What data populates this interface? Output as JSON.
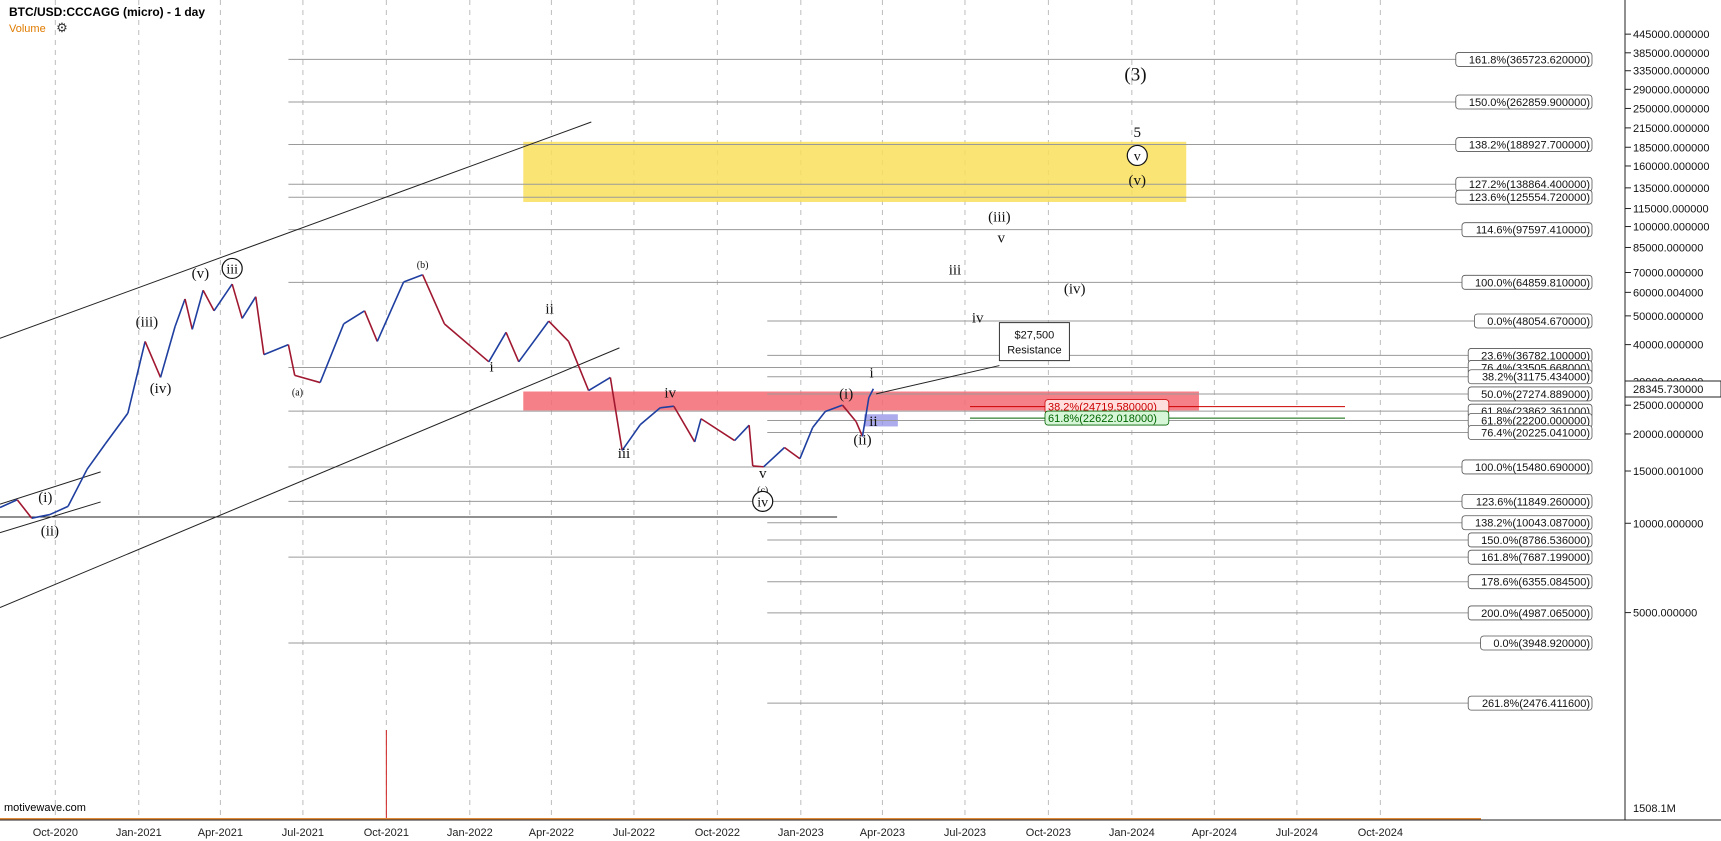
{
  "header": {
    "title": "BTC/USD:CCCAGG (micro) - 1 day",
    "volume_label": "Volume",
    "settings_icon": "gear-icon"
  },
  "watermark": "motivewave.com",
  "colors": {
    "up": "#1f3fa0",
    "down": "#a01830",
    "support_zone": "#f46a73",
    "target_zone": "#f8df5c",
    "blue_box": "#8f8fe8",
    "volume": "#d02020"
  },
  "chart_data": {
    "type": "line",
    "title": "BTC/USD:CCCAGG (micro) - 1 day",
    "y_scale": "log",
    "ylim": [
      1000,
      580000
    ],
    "xlim": [
      "2020-08-01",
      "2025-01-20"
    ],
    "x_ticks": [
      {
        "date": "2020-10-01",
        "label": "Oct-2020"
      },
      {
        "date": "2021-01-01",
        "label": "Jan-2021"
      },
      {
        "date": "2021-04-01",
        "label": "Apr-2021"
      },
      {
        "date": "2021-07-01",
        "label": "Jul-2021"
      },
      {
        "date": "2021-10-01",
        "label": "Oct-2021"
      },
      {
        "date": "2022-01-01",
        "label": "Jan-2022"
      },
      {
        "date": "2022-04-01",
        "label": "Apr-2022"
      },
      {
        "date": "2022-07-01",
        "label": "Jul-2022"
      },
      {
        "date": "2022-10-01",
        "label": "Oct-2022"
      },
      {
        "date": "2023-01-01",
        "label": "Jan-2023"
      },
      {
        "date": "2023-04-01",
        "label": "Apr-2023"
      },
      {
        "date": "2023-07-01",
        "label": "Jul-2023"
      },
      {
        "date": "2023-10-01",
        "label": "Oct-2023"
      },
      {
        "date": "2024-01-01",
        "label": "Jan-2024"
      },
      {
        "date": "2024-04-01",
        "label": "Apr-2024"
      },
      {
        "date": "2024-07-01",
        "label": "Jul-2024"
      },
      {
        "date": "2024-10-01",
        "label": "Oct-2024"
      }
    ],
    "y_ticks": [
      {
        "value": 445000,
        "label": "445000.000000"
      },
      {
        "value": 385000,
        "label": "385000.000000"
      },
      {
        "value": 335000,
        "label": "335000.000000"
      },
      {
        "value": 290000,
        "label": "290000.000000"
      },
      {
        "value": 250000,
        "label": "250000.000000"
      },
      {
        "value": 215000,
        "label": "215000.000000"
      },
      {
        "value": 185000,
        "label": "185000.000000"
      },
      {
        "value": 160000,
        "label": "160000.000000"
      },
      {
        "value": 135000,
        "label": "135000.000000"
      },
      {
        "value": 115000,
        "label": "115000.000000"
      },
      {
        "value": 100000,
        "label": "100000.000000"
      },
      {
        "value": 85000,
        "label": "85000.000000"
      },
      {
        "value": 70000,
        "label": "70000.000000"
      },
      {
        "value": 60000,
        "label": "60000.004000"
      },
      {
        "value": 50000,
        "label": "50000.000000"
      },
      {
        "value": 40000,
        "label": "40000.000000"
      },
      {
        "value": 30000,
        "label": "30000.002000"
      },
      {
        "value": 25000,
        "label": "25000.000000"
      },
      {
        "value": 20000,
        "label": "20000.000000"
      },
      {
        "value": 15000,
        "label": "15000.001000"
      },
      {
        "value": 10000,
        "label": "10000.000000"
      },
      {
        "value": 5000,
        "label": "5000.000000"
      }
    ],
    "last_price": {
      "value": 28345.73,
      "label": "28345.730000"
    },
    "volume_label": "1508.1M",
    "price_series": [
      [
        "2020-08-01",
        11300
      ],
      [
        "2020-08-20",
        12000
      ],
      [
        "2020-09-05",
        10400
      ],
      [
        "2020-09-25",
        10700
      ],
      [
        "2020-10-15",
        11400
      ],
      [
        "2020-11-05",
        15200
      ],
      [
        "2020-11-25",
        18500
      ],
      [
        "2020-12-20",
        23500
      ],
      [
        "2021-01-08",
        41000
      ],
      [
        "2021-01-25",
        31000
      ],
      [
        "2021-02-10",
        46000
      ],
      [
        "2021-02-21",
        57000
      ],
      [
        "2021-03-01",
        45000
      ],
      [
        "2021-03-13",
        61000
      ],
      [
        "2021-03-25",
        52000
      ],
      [
        "2021-04-14",
        64000
      ],
      [
        "2021-04-25",
        49000
      ],
      [
        "2021-05-10",
        58000
      ],
      [
        "2021-05-19",
        37000
      ],
      [
        "2021-06-15",
        40000
      ],
      [
        "2021-06-22",
        31500
      ],
      [
        "2021-07-20",
        29800
      ],
      [
        "2021-08-15",
        47000
      ],
      [
        "2021-09-07",
        52000
      ],
      [
        "2021-09-21",
        41000
      ],
      [
        "2021-10-20",
        65000
      ],
      [
        "2021-11-10",
        68800
      ],
      [
        "2021-12-04",
        47000
      ],
      [
        "2022-01-22",
        35000
      ],
      [
        "2022-02-10",
        44000
      ],
      [
        "2022-02-24",
        35000
      ],
      [
        "2022-03-29",
        48000
      ],
      [
        "2022-04-20",
        41000
      ],
      [
        "2022-05-12",
        28000
      ],
      [
        "2022-06-05",
        31000
      ],
      [
        "2022-06-18",
        17600
      ],
      [
        "2022-07-08",
        21500
      ],
      [
        "2022-07-30",
        24500
      ],
      [
        "2022-08-14",
        24800
      ],
      [
        "2022-09-06",
        18800
      ],
      [
        "2022-09-13",
        22500
      ],
      [
        "2022-10-20",
        19000
      ],
      [
        "2022-11-05",
        21400
      ],
      [
        "2022-11-09",
        15600
      ],
      [
        "2022-11-21",
        15500
      ],
      [
        "2022-12-14",
        18000
      ],
      [
        "2022-12-31",
        16500
      ],
      [
        "2023-01-14",
        21000
      ],
      [
        "2023-01-28",
        23800
      ],
      [
        "2023-02-16",
        25000
      ],
      [
        "2023-03-03",
        22000
      ],
      [
        "2023-03-10",
        19600
      ],
      [
        "2023-03-17",
        26500
      ],
      [
        "2023-03-22",
        28400
      ]
    ],
    "volume_spike": {
      "date": "2021-10-01",
      "value": 1508.1
    },
    "fib_levels": [
      {
        "label": "161.8%(365723.620000)",
        "value": 365723.62,
        "from": "2021-06-15"
      },
      {
        "label": "150.0%(262859.900000)",
        "value": 262859.9,
        "from": "2021-06-15"
      },
      {
        "label": "138.2%(188927.700000)",
        "value": 188927.7,
        "from": "2021-06-15"
      },
      {
        "label": "127.2%(138864.400000)",
        "value": 138864.4,
        "from": "2021-06-15"
      },
      {
        "label": "123.6%(125554.720000)",
        "value": 125554.72,
        "from": "2021-06-15"
      },
      {
        "label": "114.6%(97597.410000)",
        "value": 97597.41,
        "from": "2021-06-15"
      },
      {
        "label": "100.0%(64859.810000)",
        "value": 64859.81,
        "from": "2021-06-15"
      },
      {
        "label": "0.0%(48054.670000)",
        "value": 48054.67,
        "from": "2022-11-25"
      },
      {
        "label": "23.6%(36782.100000)",
        "value": 36782.1,
        "from": "2022-11-25"
      },
      {
        "label": "76.4%(33505.668000)",
        "value": 33505.668,
        "from": "2021-06-15"
      },
      {
        "label": "38.2%(31175.434000)",
        "value": 31175.434,
        "from": "2022-11-25"
      },
      {
        "label": "50.0%(27274.889000)",
        "value": 27274.889,
        "from": "2022-11-25"
      },
      {
        "label": "61.8%(23862.361000)",
        "value": 23862.361,
        "from": "2021-06-15"
      },
      {
        "label": "61.8%(22200.000000)",
        "value": 22200,
        "from": "2022-11-25"
      },
      {
        "label": "76.4%(20225.041000)",
        "value": 20225.041,
        "from": "2022-11-25"
      },
      {
        "label": "100.0%(15480.690000)",
        "value": 15480.69,
        "from": "2021-06-15"
      },
      {
        "label": "123.6%(11849.260000)",
        "value": 11849.26,
        "from": "2021-06-15"
      },
      {
        "label": "138.2%(10043.087000)",
        "value": 10043.087,
        "from": "2022-11-25"
      },
      {
        "label": "150.0%(8786.536000)",
        "value": 8786.536,
        "from": "2022-11-25"
      },
      {
        "label": "161.8%(7687.199000)",
        "value": 7687.199,
        "from": "2021-06-15"
      },
      {
        "label": "178.6%(6355.084500)",
        "value": 6355.0845,
        "from": "2022-11-25"
      },
      {
        "label": "200.0%(4987.065000)",
        "value": 4987.065,
        "from": "2022-11-25"
      },
      {
        "label": "0.0%(3948.920000)",
        "value": 3948.92,
        "from": "2021-06-15"
      },
      {
        "label": "261.8%(2476.411600)",
        "value": 2476.4116,
        "from": "2022-11-25"
      }
    ],
    "fib_inner": [
      {
        "label": "38.2%(24719.580000)",
        "value": 24719.58,
        "color": "#cc0000",
        "bg": "#ffdede"
      },
      {
        "label": "61.8%(22622.018000)",
        "value": 22622.018,
        "color": "#006600",
        "bg": "#d7f5d7"
      }
    ],
    "zones": [
      {
        "name": "target-zone",
        "from": "2022-03-01",
        "to": "2024-03-01",
        "low": 121000,
        "high": 193000
      },
      {
        "name": "support-zone",
        "from": "2022-03-01",
        "to": "2024-03-15",
        "low": 24000,
        "high": 27800
      },
      {
        "name": "blue-box",
        "from": "2023-03-12",
        "to": "2023-04-18",
        "low": 21200,
        "high": 23300
      }
    ],
    "trendlines": [
      {
        "name": "channel-top",
        "from": [
          "2020-08-01",
          42000
        ],
        "to": [
          "2022-05-15",
          225000
        ]
      },
      {
        "name": "channel-bottom",
        "from": [
          "2020-08-01",
          5200
        ],
        "to": [
          "2022-06-15",
          39000
        ]
      },
      {
        "name": "small-channel-top",
        "from": [
          "2020-08-01",
          11600
        ],
        "to": [
          "2020-11-20",
          14900
        ]
      },
      {
        "name": "small-channel-bottom",
        "from": [
          "2020-08-01",
          9300
        ],
        "to": [
          "2020-11-20",
          11800
        ]
      },
      {
        "name": "support-line",
        "from": [
          "2020-08-01",
          10500
        ],
        "to": [
          "2023-02-10",
          10500
        ]
      },
      {
        "name": "callout-leader",
        "from": [
          "2023-03-25",
          27300
        ],
        "to": [
          "2023-08-08",
          34000
        ]
      }
    ],
    "annotations": [
      {
        "text": "(i)",
        "date": "2020-09-20",
        "value": 11800,
        "size": 15
      },
      {
        "text": "(ii)",
        "date": "2020-09-25",
        "value": 9100,
        "size": 15
      },
      {
        "text": "(iii)",
        "date": "2021-01-10",
        "value": 46000,
        "size": 15
      },
      {
        "text": "(iv)",
        "date": "2021-01-25",
        "value": 27500,
        "size": 15
      },
      {
        "text": "(v)",
        "date": "2021-03-10",
        "value": 67000,
        "size": 15
      },
      {
        "text": "iii",
        "date": "2021-04-14",
        "value": 69500,
        "size": 14,
        "circle": true
      },
      {
        "text": "(a)",
        "date": "2021-06-25",
        "value": 27000,
        "size": 10
      },
      {
        "text": "(b)",
        "date": "2021-11-10",
        "value": 72500,
        "size": 10
      },
      {
        "text": "ii",
        "date": "2022-03-30",
        "value": 51000,
        "size": 15
      },
      {
        "text": "i",
        "date": "2022-01-25",
        "value": 32500,
        "size": 15
      },
      {
        "text": "iii",
        "date": "2022-06-20",
        "value": 16600,
        "size": 15
      },
      {
        "text": "iv",
        "date": "2022-08-10",
        "value": 26500,
        "size": 15
      },
      {
        "text": "v",
        "date": "2022-11-20",
        "value": 14200,
        "size": 15
      },
      {
        "text": "(c)",
        "date": "2022-11-20",
        "value": 12600,
        "size": 10
      },
      {
        "text": "iv",
        "date": "2022-11-20",
        "value": 11400,
        "size": 14,
        "circle": true
      },
      {
        "text": "(i)",
        "date": "2023-02-20",
        "value": 26300,
        "size": 15
      },
      {
        "text": "(ii)",
        "date": "2023-03-10",
        "value": 18400,
        "size": 15
      },
      {
        "text": "i",
        "date": "2023-03-20",
        "value": 31000,
        "size": 15
      },
      {
        "text": "ii",
        "date": "2023-03-22",
        "value": 21300,
        "size": 15
      },
      {
        "text": "iii",
        "date": "2023-06-20",
        "value": 69000,
        "size": 15
      },
      {
        "text": "iv",
        "date": "2023-07-15",
        "value": 47500,
        "size": 15
      },
      {
        "text": "(iii)",
        "date": "2023-08-08",
        "value": 104000,
        "size": 15
      },
      {
        "text": "v",
        "date": "2023-08-10",
        "value": 88500,
        "size": 15
      },
      {
        "text": "(iv)",
        "date": "2023-10-30",
        "value": 59500,
        "size": 15
      },
      {
        "text": "(3)",
        "date": "2024-01-05",
        "value": 310000,
        "size": 19
      },
      {
        "text": "5",
        "date": "2024-01-07",
        "value": 200000,
        "size": 15
      },
      {
        "text": "v",
        "date": "2024-01-07",
        "value": 167000,
        "size": 14,
        "circle": true
      },
      {
        "text": "(v)",
        "date": "2024-01-07",
        "value": 138000,
        "size": 15
      }
    ],
    "callout": {
      "line1": "$27,500",
      "line2": "Resistance",
      "date": "2023-08-08",
      "value": 40000
    }
  }
}
